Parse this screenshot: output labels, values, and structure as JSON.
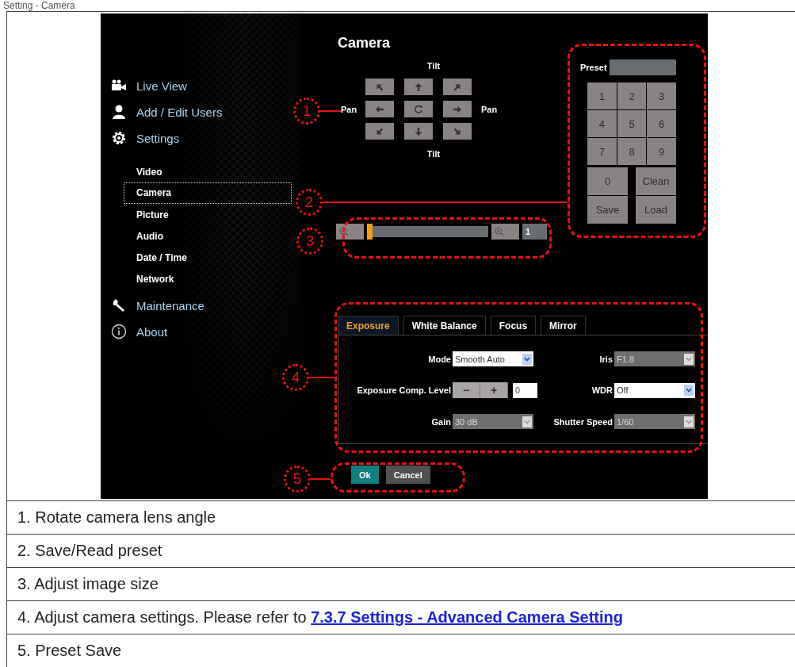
{
  "heading": "Setting - Camera",
  "screen": {
    "nav": [
      {
        "label": "Live View"
      },
      {
        "label": "Add / Edit Users"
      },
      {
        "label": "Settings",
        "children": [
          {
            "label": "Video",
            "selected": false
          },
          {
            "label": "Camera",
            "selected": true
          },
          {
            "label": "Picture",
            "selected": false
          },
          {
            "label": "Audio",
            "selected": false
          },
          {
            "label": "Date / Time",
            "selected": false
          },
          {
            "label": "Network",
            "selected": false
          }
        ]
      },
      {
        "label": "Maintenance"
      },
      {
        "label": "About"
      }
    ],
    "title": "Camera",
    "ptz": {
      "tilt_top": "Tilt",
      "tilt_bottom": "Tilt",
      "pan_left": "Pan",
      "pan_right": "Pan"
    },
    "preset": {
      "label": "Preset",
      "keys": [
        "1",
        "2",
        "3",
        "4",
        "5",
        "6",
        "7",
        "8",
        "9"
      ],
      "actions": [
        "0",
        "Clean",
        "Save",
        "Load"
      ]
    },
    "zoom": {
      "level": 0,
      "value": "1"
    },
    "tabs": [
      {
        "label": "Exposure",
        "selected": true
      },
      {
        "label": "White Balance",
        "selected": false
      },
      {
        "label": "Focus",
        "selected": false
      },
      {
        "label": "Mirror",
        "selected": false
      }
    ],
    "fields": [
      {
        "label": "Mode",
        "kind": "select",
        "value": "Smooth Auto",
        "disabled": false
      },
      {
        "label": "Iris",
        "kind": "select",
        "value": "F1.8",
        "disabled": true
      },
      {
        "label": "Exposure Comp. Level",
        "kind": "stepper",
        "minus": "−",
        "plus": "+",
        "value": "0"
      },
      {
        "label": "WDR",
        "kind": "select",
        "value": "Off",
        "disabled": false
      },
      {
        "label": "Gain",
        "kind": "select",
        "value": "30 dB",
        "disabled": true
      },
      {
        "label": "Shutter Speed",
        "kind": "select",
        "value": "1/60",
        "disabled": true
      }
    ],
    "buttons": [
      {
        "label": "Ok",
        "kind": "primary"
      },
      {
        "label": "Cancel",
        "kind": "secondary"
      }
    ],
    "callouts": [
      "1",
      "2",
      "3",
      "4",
      "5"
    ]
  },
  "notes": [
    {
      "text": "1. Rotate camera lens angle"
    },
    {
      "text": "2. Save/Read preset"
    },
    {
      "text": "3. Adjust image size"
    },
    {
      "text": "4. Adjust camera settings. Please refer to ",
      "link": "7.3.7 Settings - Advanced Camera Setting"
    },
    {
      "text": "5. Preset Save"
    }
  ]
}
